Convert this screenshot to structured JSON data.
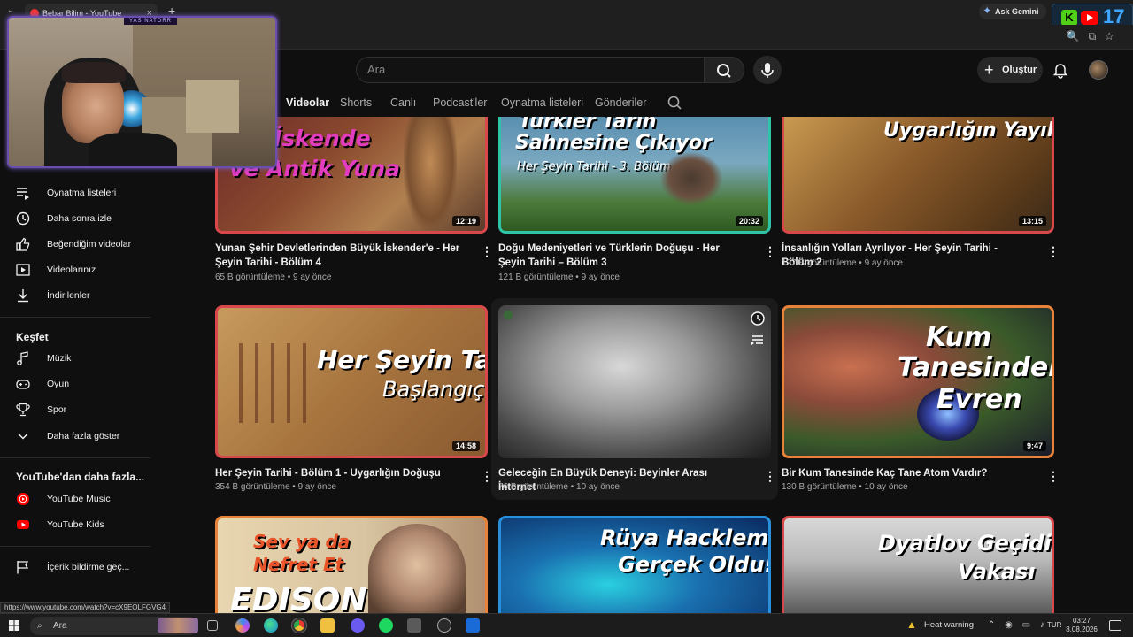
{
  "browser": {
    "tab_title": "Bebar Bilim - YouTube",
    "tab_close": "×",
    "new_tab": "+",
    "tab_list": "⌄",
    "ask_gemini": "Ask Gemini",
    "ext_k": "K",
    "ext_counter": "17",
    "status_url": "https://www.youtube.com/watch?v=cX9EOLFGVG4"
  },
  "youtube": {
    "search_placeholder": "Ara",
    "create_label": "Oluştur",
    "channel_tabs": [
      "Videolar",
      "Shorts",
      "Canlı",
      "Podcast'ler",
      "Oynatma listeleri",
      "Gönderiler"
    ],
    "active_tab": "Videolar"
  },
  "sidebar": {
    "items": [
      {
        "label": "Oynatma listeleri",
        "icon": "playlist-icon"
      },
      {
        "label": "Daha sonra izle",
        "icon": "clock-icon"
      },
      {
        "label": "Beğendiğim videolar",
        "icon": "thumbs-up-icon"
      },
      {
        "label": "Videolarınız",
        "icon": "video-icon"
      },
      {
        "label": "İndirilenler",
        "icon": "download-icon"
      }
    ],
    "explore_title": "Keşfet",
    "explore_items": [
      {
        "label": "Müzik",
        "icon": "music-icon"
      },
      {
        "label": "Oyun",
        "icon": "gamepad-icon"
      },
      {
        "label": "Spor",
        "icon": "trophy-icon"
      },
      {
        "label": "Daha fazla göster",
        "icon": "chevron-down-icon"
      }
    ],
    "more_title": "YouTube'dan daha fazla...",
    "more_items": [
      {
        "label": "YouTube Music",
        "icon": "youtube-music-icon"
      },
      {
        "label": "YouTube Kids",
        "icon": "youtube-kids-icon"
      }
    ],
    "report_label": "İçerik bildirme geç..."
  },
  "webcam": {
    "overlay_label": "YASINATORR"
  },
  "videos": [
    {
      "title": "Yunan Şehir Devletlerinden Büyük İskender'e - Her Şeyin Tarihi - Bölüm 4",
      "views": "65 B görüntüleme",
      "age": "9 ay önce",
      "duration": "12:19",
      "thumb_text": [
        "ük İskende",
        "Ve Antik Yuna"
      ]
    },
    {
      "title": "Doğu Medeniyetleri ve Türklerin Doğuşu - Her Şeyin Tarihi – Bölüm 3",
      "views": "121 B görüntüleme",
      "age": "9 ay önce",
      "duration": "20:32",
      "thumb_text": [
        "Türkler Tarih",
        "Sahnesine Çıkıyor",
        "Her Şeyin Tarihi - 3. Bölüm"
      ]
    },
    {
      "title": "İnsanlığın Yolları Ayrılıyor - Her Şeyin Tarihi - Bölüm 2",
      "views": "127 B görüntüleme",
      "age": "9 ay önce",
      "duration": "13:15",
      "thumb_text": [
        "Uygarlığın Yayılışı"
      ]
    },
    {
      "title": "Her Şeyin Tarihi - Bölüm 1 - Uygarlığın Doğuşu",
      "views": "354 B görüntüleme",
      "age": "9 ay önce",
      "duration": "14:58",
      "thumb_text": [
        "Her Şeyin Tarihi",
        "Başlangıç"
      ]
    },
    {
      "title": "Geleceğin En Büyük Deneyi: Beyinler Arası İnternet",
      "views": "76 B görüntüleme",
      "age": "10 ay önce",
      "duration": "",
      "thumb_text": []
    },
    {
      "title": "Bir Kum Tanesinde Kaç Tane Atom Vardır?",
      "views": "130 B görüntüleme",
      "age": "10 ay önce",
      "duration": "9:47",
      "thumb_text": [
        "Kum",
        "Tanesindeki",
        "Evren"
      ]
    },
    {
      "title": "",
      "views": "",
      "age": "",
      "duration": "",
      "thumb_text": [
        "Sev ya da",
        "Nefret Et",
        "EDISON"
      ]
    },
    {
      "title": "",
      "views": "",
      "age": "",
      "duration": "",
      "thumb_text": [
        "Rüya Hackleme",
        "Gerçek Oldu!"
      ]
    },
    {
      "title": "",
      "views": "",
      "age": "",
      "duration": "",
      "thumb_text": [
        "Dyatlov Geçidi",
        "Vakası"
      ]
    }
  ],
  "taskbar": {
    "search_label": "Ara",
    "weather": "Heat warning",
    "lang": "TUR",
    "time": "03:27",
    "date": "8.08.2026"
  },
  "colors": {
    "youtube_red": "#ff0000",
    "thumb_border_red": "#d8484b",
    "thumb_border_blue": "#2a8fd8",
    "thumb_border_orange": "#e8823a",
    "background": "#0f0f0f"
  }
}
